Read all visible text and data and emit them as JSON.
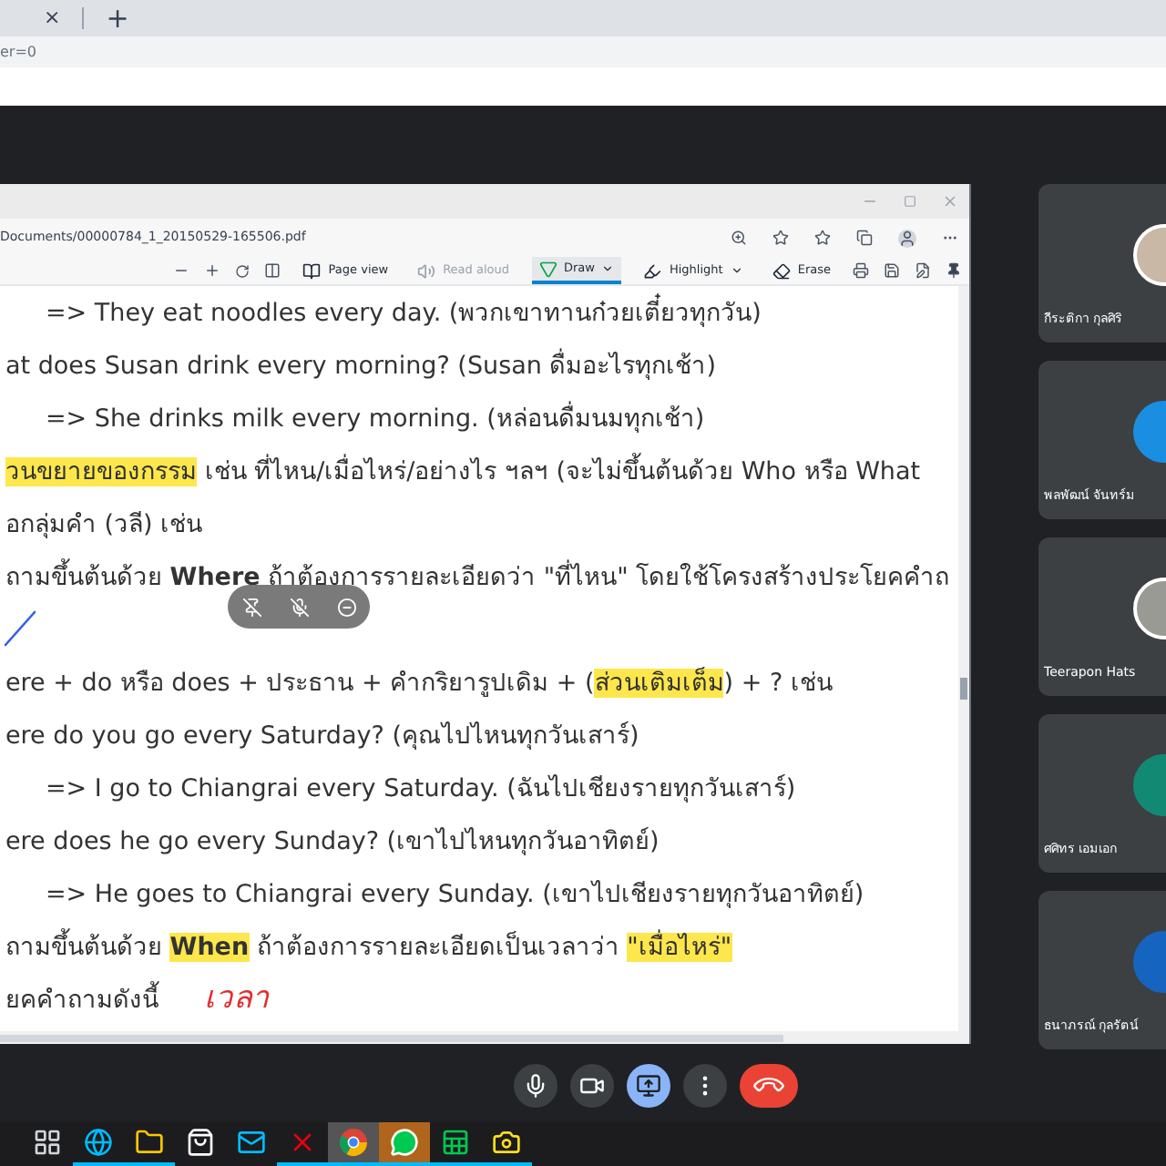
{
  "browser": {
    "tab_close": "×",
    "new_tab": "+",
    "address": "er=0"
  },
  "pdf_window": {
    "path": "Documents/00000784_1_20150529-165506.pdf",
    "tools": [
      {
        "kind": "page-view",
        "label": "Page view",
        "disabled": false,
        "selected": false,
        "dropdown": false
      },
      {
        "kind": "read-aloud",
        "label": "Read aloud",
        "disabled": true,
        "selected": false,
        "dropdown": false
      },
      {
        "kind": "draw",
        "label": "Draw",
        "disabled": false,
        "selected": true,
        "dropdown": true
      },
      {
        "kind": "highlight",
        "label": "Highlight",
        "disabled": false,
        "selected": false,
        "dropdown": true
      },
      {
        "kind": "erase",
        "label": "Erase",
        "disabled": false,
        "selected": false,
        "dropdown": false
      }
    ],
    "lines": [
      {
        "indent": true,
        "segments": [
          {
            "text": "=> They eat noodles every day. (พวกเขาทานก๋วยเตี๋ยวทุกวัน)",
            "highlight": false
          }
        ]
      },
      {
        "indent": false,
        "segments": [
          {
            "text": "at does Susan drink every morning? (Susan ดื่มอะไรทุกเช้า)",
            "highlight": false
          }
        ]
      },
      {
        "indent": true,
        "segments": [
          {
            "text": "=> She drinks milk every morning. (หล่อนดื่มนมทุกเช้า)",
            "highlight": false
          }
        ]
      },
      {
        "indent": false,
        "segments": [
          {
            "text": "วนขยายของกรรม",
            "highlight": true
          },
          {
            "text": "  เช่น ที่ไหน/เมื่อไหร่/อย่างไร ฯลฯ (จะไม่ขึ้นต้นด้วย Who หรือ What",
            "highlight": false
          }
        ]
      },
      {
        "indent": false,
        "segments": [
          {
            "text": "อกลุ่มคำ (วลี) เช่น",
            "highlight": false
          }
        ]
      },
      {
        "indent": false,
        "segments": [
          {
            "text": "ถามขึ้นต้นด้วย **Where** ถ้าต้องการรายละเอียดว่า \"ที่ไหน\"  โดยใช้โครงสร้างประโยคคำถ",
            "highlight": false
          }
        ]
      },
      {
        "indent": false
      },
      {
        "indent": false,
        "segments": [
          {
            "text": "ere + do หรือ does + ประธาน + คำกริยารูปเดิม + (",
            "highlight": false
          },
          {
            "text": "ส่วนเติมเต็ม",
            "highlight": true
          },
          {
            "text": ") + ? เช่น",
            "highlight": false
          }
        ]
      },
      {
        "indent": false,
        "segments": [
          {
            "text": "ere do you go every Saturday? (คุณไปไหนทุกวันเสาร์)",
            "highlight": false
          }
        ]
      },
      {
        "indent": true,
        "segments": [
          {
            "text": "=> I go to Chiangrai every Saturday. (ฉันไปเชียงรายทุกวันเสาร์)",
            "highlight": false
          }
        ]
      },
      {
        "indent": false,
        "segments": [
          {
            "text": "ere does he go every Sunday? (เขาไปไหนทุกวันอาทิตย์)",
            "highlight": false
          }
        ]
      },
      {
        "indent": true,
        "segments": [
          {
            "text": "=> He goes to Chiangrai every Sunday. (เขาไปเชียงรายทุกวันอาทิตย์)",
            "highlight": false
          }
        ]
      },
      {
        "indent": false,
        "segments": [
          {
            "text": "ถามขึ้นต้นด้วย ",
            "highlight": false
          },
          {
            "text": "**When**",
            "highlight": true
          },
          {
            "text": "  ถ้าต้องการรายละเอียดเป็นเวลาว่า ",
            "highlight": false
          },
          {
            "text": "\"เมื่อไหร่\"",
            "highlight": true
          }
        ]
      },
      {
        "indent": false,
        "segments": [
          {
            "text": "ยคคำถามดังนี้",
            "highlight": false
          }
        ],
        "note": "เวลา"
      }
    ]
  },
  "participants": [
    {
      "name": "กีระติกา กุลศิริ",
      "kind": "photo",
      "color": "#c9b8a6"
    },
    {
      "name": "พลพัฒน์ จันทร์ม",
      "kind": "plain",
      "color": "#1a8ee0"
    },
    {
      "name": "Teerapon Hats",
      "kind": "photo",
      "color": "#9a9a94"
    },
    {
      "name": "ศศิทร เอมเอก",
      "kind": "plain",
      "color": "#128a73"
    },
    {
      "name": "ธนาภรณ์ กุลรัตน์",
      "kind": "plain",
      "color": "#1565c0"
    }
  ],
  "call_controls": [
    {
      "kind": "mic",
      "selected": false
    },
    {
      "kind": "camera",
      "selected": false
    },
    {
      "kind": "present",
      "selected": true
    },
    {
      "kind": "more",
      "selected": false
    },
    {
      "kind": "hangup",
      "selected": false
    }
  ],
  "taskbar": [
    {
      "kind": "task-view",
      "running": false,
      "selected": false,
      "attention": false
    },
    {
      "kind": "edge",
      "running": true,
      "selected": false,
      "attention": false
    },
    {
      "kind": "explorer",
      "running": true,
      "selected": false,
      "attention": false
    },
    {
      "kind": "store",
      "running": false,
      "selected": false,
      "attention": false
    },
    {
      "kind": "mail",
      "running": false,
      "selected": false,
      "attention": false
    },
    {
      "kind": "x-app",
      "running": true,
      "selected": false,
      "attention": false
    },
    {
      "kind": "chrome",
      "running": true,
      "selected": true,
      "attention": false
    },
    {
      "kind": "chat",
      "running": true,
      "selected": false,
      "attention": true
    },
    {
      "kind": "excel",
      "running": true,
      "selected": false,
      "attention": false
    },
    {
      "kind": "camera-app",
      "running": true,
      "selected": false,
      "attention": false
    }
  ]
}
